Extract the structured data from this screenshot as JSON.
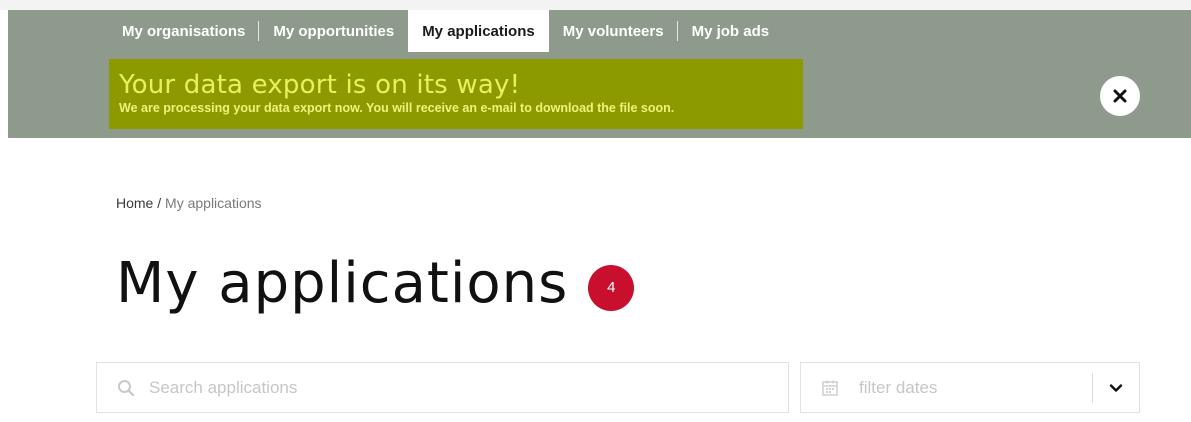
{
  "nav": {
    "tabs": [
      {
        "label": "My organisations",
        "active": false
      },
      {
        "label": "My opportunities",
        "active": false
      },
      {
        "label": "My applications",
        "active": true
      },
      {
        "label": "My volunteers",
        "active": false
      },
      {
        "label": "My job ads",
        "active": false
      }
    ]
  },
  "notice": {
    "title": "Your data export is on its way!",
    "body": "We are processing your data export now. You will receive an e-mail to download the file soon."
  },
  "breadcrumb": {
    "home": "Home",
    "separator": "/",
    "current": "My applications"
  },
  "page": {
    "title": "My applications",
    "count": "4"
  },
  "search": {
    "placeholder": "Search applications",
    "value": ""
  },
  "date_filter": {
    "placeholder": "filter dates"
  },
  "icons": {
    "close": "close-icon",
    "search": "search-icon",
    "calendar": "calendar-icon",
    "dropdown": "chevron-down-icon"
  },
  "colors": {
    "header_bg": "#8e9a8c",
    "notice_bg": "#8c9a00",
    "notice_text": "#e8f05a",
    "badge": "#c8102e"
  }
}
